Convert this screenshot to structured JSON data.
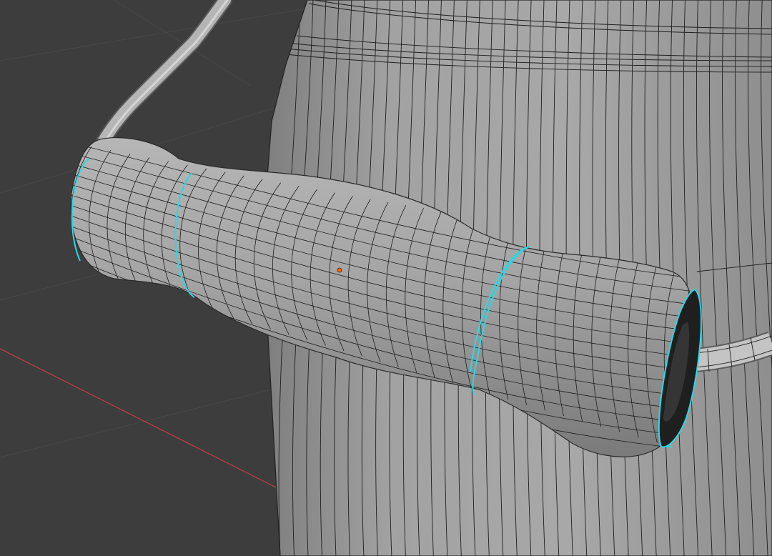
{
  "viewport": {
    "kind": "3d-viewport",
    "mode": "edit-mode",
    "background_color": "#3d3d3d",
    "grid_line_color": "#4a4a4a",
    "axis_x_color": "#b8404a",
    "mesh_color": "#9a9a9a",
    "wire_color": "#1a1a1a",
    "selection_color": "#2ad8e6",
    "origin_color": "#ff6a00"
  },
  "scene": {
    "objects": [
      {
        "name": "milk-can-body",
        "selected": false
      },
      {
        "name": "handle-grip",
        "selected": true
      },
      {
        "name": "handle-wire",
        "selected": false
      }
    ]
  }
}
